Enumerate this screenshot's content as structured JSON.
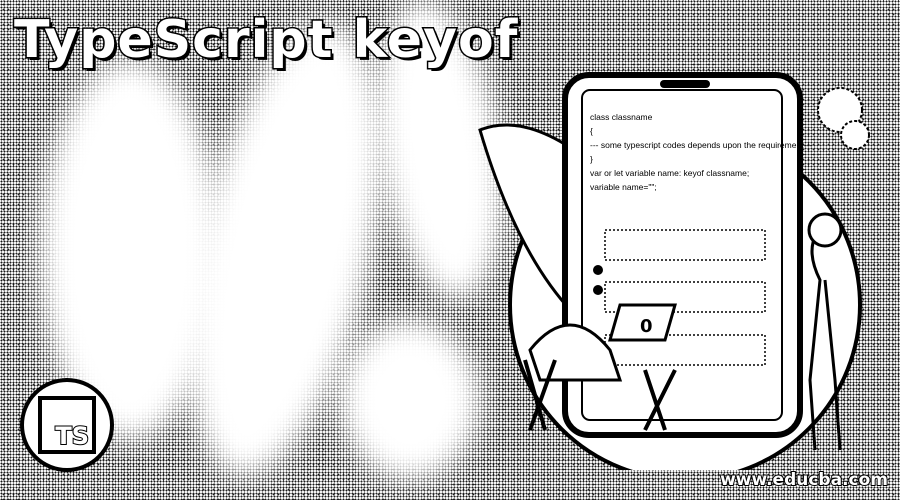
{
  "banner": {
    "title": "TypeScript keyof",
    "logo_text": "TS",
    "website": "www.educba.com"
  },
  "code_lines": [
    "class classname",
    "{",
    "--- some typescript codes depends upon the requirement---",
    "}",
    "var or let variable name: keyof  classname;",
    "variable  name=\"\";"
  ],
  "laptop_symbol": "0"
}
